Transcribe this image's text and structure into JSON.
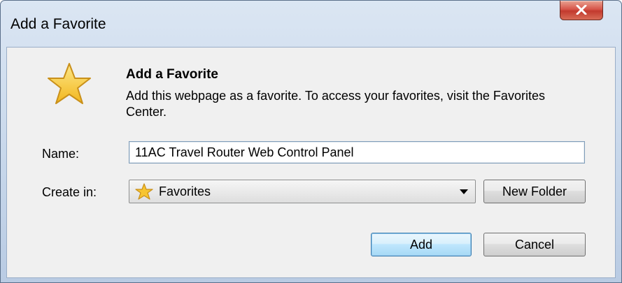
{
  "window": {
    "title": "Add a Favorite"
  },
  "dialog": {
    "heading": "Add a Favorite",
    "description": "Add this webpage as a favorite. To access your favorites, visit the Favorites Center."
  },
  "form": {
    "name_label": "Name:",
    "name_value": "11AC Travel Router Web Control Panel",
    "create_in_label": "Create in:",
    "create_in_value": "Favorites"
  },
  "buttons": {
    "new_folder": "New Folder",
    "add": "Add",
    "cancel": "Cancel"
  },
  "icons": {
    "dialog_icon": "star-icon",
    "folder_icon": "favorites-star-icon",
    "close_icon": "close-icon"
  },
  "colors": {
    "star_fill": "#f7c531",
    "close_button": "#c94a3c",
    "default_button_border": "#3c7fb1"
  }
}
